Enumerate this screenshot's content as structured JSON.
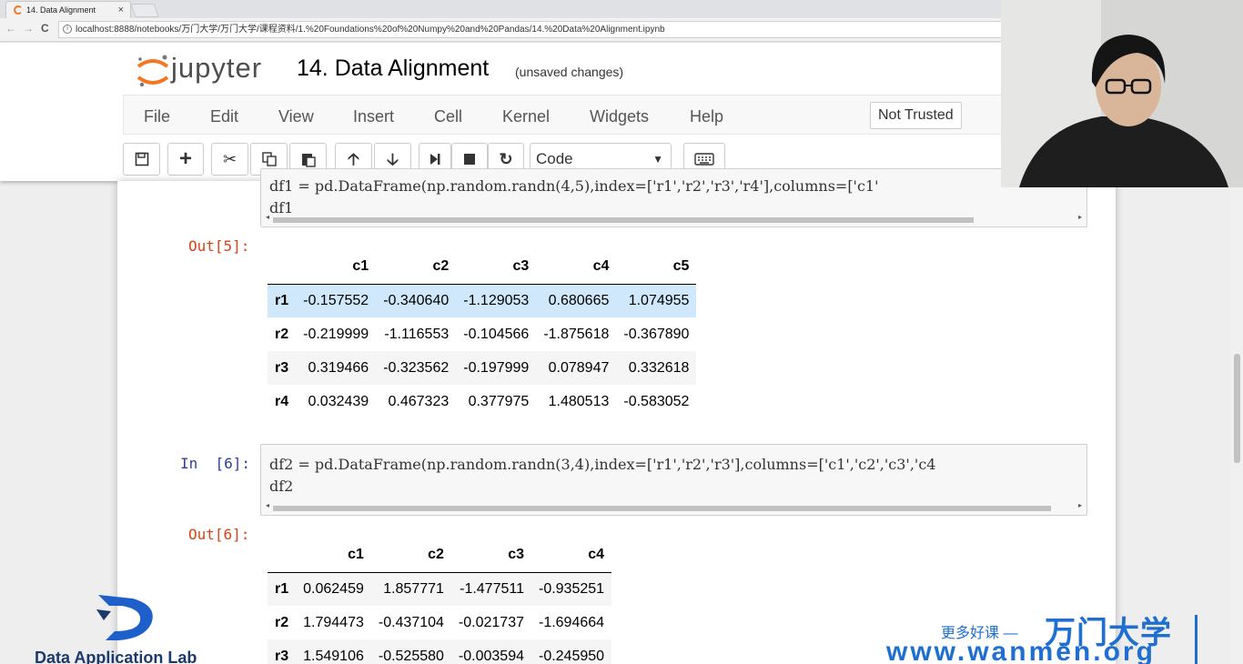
{
  "browser": {
    "tab_title": "14. Data Alignment",
    "tab_close": "×",
    "url": "localhost:8888/notebooks/万门大学/万门大学/课程资料/1.%20Foundations%20of%20Numpy%20and%20Pandas/14.%20Data%20Alignment.ipynb",
    "back": "←",
    "forward": "→",
    "reload": "C"
  },
  "jupyter": {
    "logo_text": "jupyter",
    "notebook_title": "14. Data Alignment",
    "save_status": "(unsaved changes)",
    "menu": [
      "File",
      "Edit",
      "View",
      "Insert",
      "Cell",
      "Kernel",
      "Widgets",
      "Help"
    ],
    "trusted_label": "Not Trusted",
    "cell_type": "Code",
    "colors": {
      "prompt_in": "#303f9f",
      "prompt_out": "#d84315",
      "selected_row": "#cfe8fc"
    }
  },
  "toolbar_icons": [
    "save-icon",
    "plus-icon",
    "scissors-icon",
    "copy-icon",
    "paste-icon",
    "arrow-up-icon",
    "arrow-down-icon",
    "step-forward-icon",
    "stop-icon",
    "restart-icon",
    "keyboard-icon"
  ],
  "cells": {
    "cell5": {
      "code_line1": "df1 = pd.DataFrame(np.random.randn(4,5),index=['r1','r2','r3','r4'],columns=['c1'",
      "code_line2": "df1",
      "out_prompt": "Out[5]:",
      "columns": [
        "",
        "c1",
        "c2",
        "c3",
        "c4",
        "c5"
      ],
      "rows": [
        [
          "r1",
          "-0.157552",
          "-0.340640",
          "-1.129053",
          "0.680665",
          "1.074955"
        ],
        [
          "r2",
          "-0.219999",
          "-1.116553",
          "-0.104566",
          "-1.875618",
          "-0.367890"
        ],
        [
          "r3",
          "0.319466",
          "-0.323562",
          "-0.197999",
          "0.078947",
          "0.332618"
        ],
        [
          "r4",
          "0.032439",
          "0.467323",
          "0.377975",
          "1.480513",
          "-0.583052"
        ]
      ]
    },
    "cell6": {
      "in_prompt": "In  [6]:",
      "code_line1": "df2 = pd.DataFrame(np.random.randn(3,4),index=['r1','r2','r3'],columns=['c1','c2','c3','c4",
      "code_line2": "df2",
      "out_prompt": "Out[6]:",
      "columns": [
        "",
        "c1",
        "c2",
        "c3",
        "c4"
      ],
      "rows": [
        [
          "r1",
          "0.062459",
          "1.857771",
          "-1.477511",
          "-0.935251"
        ],
        [
          "r2",
          "1.794473",
          "-0.437104",
          "-0.021737",
          "-1.694664"
        ],
        [
          "r3",
          "1.549106",
          "-0.525580",
          "-0.003594",
          "-0.245950"
        ]
      ]
    }
  },
  "overlays": {
    "lab_name": "Data Application Lab",
    "wanmen_tagline": "更多好课 —",
    "wanmen_name": "万门大学",
    "wanmen_url": "www.wanmen.org"
  }
}
